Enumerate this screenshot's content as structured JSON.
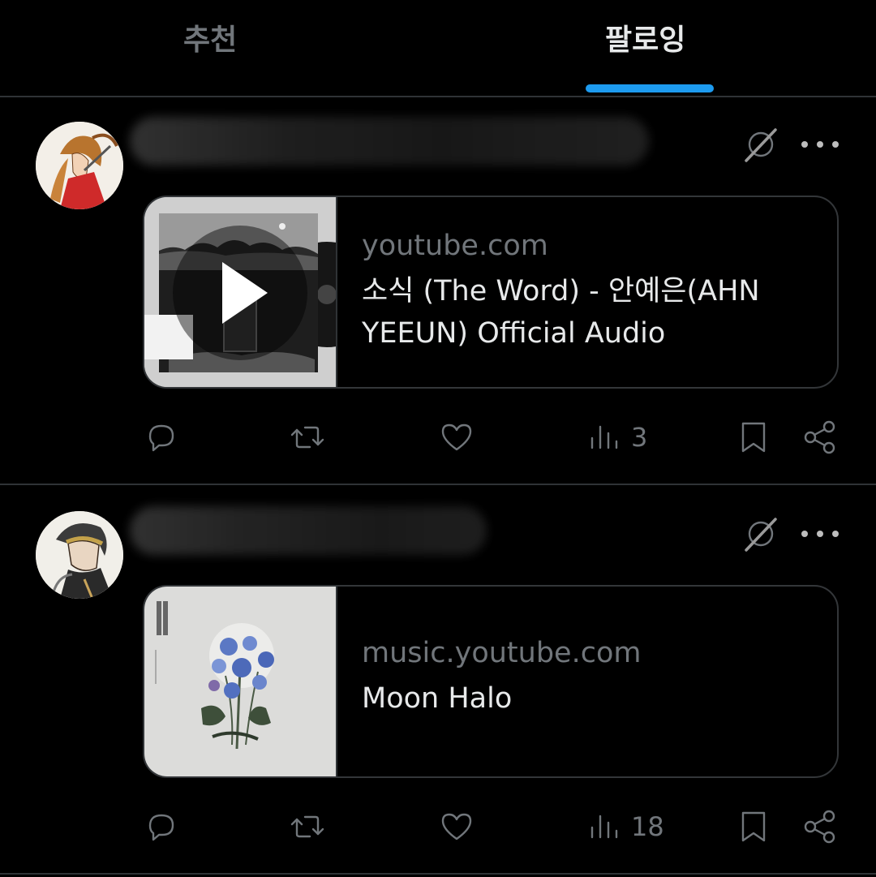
{
  "tabs": [
    {
      "label": "추천",
      "active": false
    },
    {
      "label": "팔로잉",
      "active": true
    }
  ],
  "colors": {
    "accent": "#1d9bf0",
    "background": "#000000",
    "muted": "#71767b"
  },
  "posts": [
    {
      "card": {
        "domain": "youtube.com",
        "title": "소식 (The Word) - 안예은(AHN YEEUN) Official Audio",
        "media": "video-thumbnail"
      },
      "actions": {
        "views": "3"
      }
    },
    {
      "card": {
        "domain": "music.youtube.com",
        "title": "Moon Halo",
        "media": "album-art"
      },
      "actions": {
        "views": "18"
      }
    }
  ]
}
